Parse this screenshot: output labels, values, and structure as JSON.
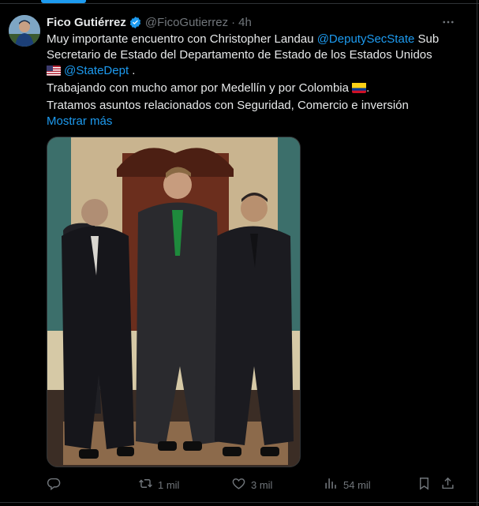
{
  "tweet": {
    "author_name": "Fico Gutiérrez",
    "handle": "@FicoGutierrez",
    "separator": "·",
    "time": "4h",
    "text": {
      "line1_a": "Muy importante encuentro con Christopher Landau ",
      "line1_mention": "@DeputySecState",
      "line1_b": "  Sub",
      "line2": "Secretario de Estado del Departamento de Estado de los Estados  Unidos",
      "line3_mention": "@StateDept",
      "line3_b": " .",
      "line4": "Trabajando con mucho amor por Medellín y por Colombia ",
      "line4_end": ".",
      "line5": "Tratamos asuntos relacionados con Seguridad, Comercio e inversión"
    },
    "show_more": "Mostrar más"
  },
  "actions": {
    "reply_count": "",
    "retweet_count": "1 mil",
    "like_count": "3 mil",
    "views_count": "54 mil"
  },
  "colors": {
    "background": "#000000",
    "text": "#e7e9ea",
    "muted": "#71767b",
    "accent": "#1d9bf0",
    "border": "#2f3336"
  },
  "icons": [
    "verified-badge-icon",
    "more-icon",
    "us-flag-icon",
    "colombia-flag-icon",
    "reply-icon",
    "retweet-icon",
    "like-icon",
    "views-icon",
    "bookmark-icon",
    "share-icon"
  ]
}
